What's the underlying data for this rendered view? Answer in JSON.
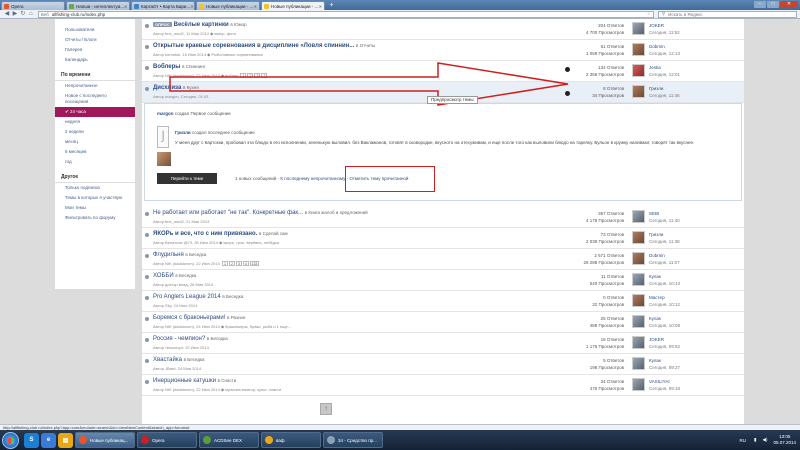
{
  "browser": {
    "tabs": [
      {
        "label": "Opera",
        "active": false
      },
      {
        "label": "Напша - интеллектуа...",
        "active": false
      },
      {
        "label": "КартаОт • Карта Бари...",
        "active": false
      },
      {
        "label": "Новые публикации - ...",
        "active": false
      },
      {
        "label": "Новые публикации - ...",
        "active": true
      }
    ],
    "url_prefix": "Веб",
    "url": "allfishing-club.ru/index.php",
    "search_placeholder": "Искать в Яндекс"
  },
  "sidebar": {
    "top_items": [
      "Пользователи",
      "Отчеты / Блоги",
      "Галерея",
      "Календарь"
    ],
    "section_time": "По времени",
    "time_items": [
      {
        "label": "Непрочитанное",
        "active": false
      },
      {
        "label": "Новое с последнего посещения",
        "active": false
      },
      {
        "label": "24 часа",
        "active": true
      },
      {
        "label": "неделя",
        "active": false
      },
      {
        "label": "2 недели",
        "active": false
      },
      {
        "label": "месяц",
        "active": false
      },
      {
        "label": "6 месяцев",
        "active": false
      },
      {
        "label": "год",
        "active": false
      }
    ],
    "section_other": "Другое",
    "other_items": [
      "Только подписка",
      "Темы в которых я участвую",
      "Мои темы",
      "Фильтровать по форуму"
    ]
  },
  "topics": [
    {
      "tag": "ОПРОС",
      "title": "Весёлые картинки",
      "forum": "в Юмор",
      "meta": "Автор text_mod2, 11 Мая 2014",
      "extra": "юмор, фото",
      "replies": "204 Ответов",
      "views": "4 700 Просмотров",
      "user": "JOKER",
      "time": "Сегодня, 11:52",
      "bold": true
    },
    {
      "tag": "",
      "title": "Открытые краевые соревнования в дисциплине «Ловля спиннин...",
      "forum": "в Отчеты",
      "meta": "Автор kornstok, 15 Июн 2014",
      "extra": "Рыболовные соревнования",
      "replies": "51 Ответов",
      "views": "1 059 Просмотров",
      "user": "Dobrnin",
      "time": "Сегодня, 12:13",
      "bold": true
    },
    {
      "tag": "",
      "title": "Воблеры",
      "forum": "в Спиннинг",
      "meta": "Автор NIK (dadukovm), 22 Июн 2014",
      "extra": "воблер",
      "pages": [
        "1",
        "2",
        "3",
        "7"
      ],
      "replies": "134 Ответов",
      "views": "2 356 Просмотров",
      "user": "Jeska",
      "time": "Сегодня, 12:01",
      "bold": true
    },
    {
      "tag": "",
      "title": "Дисхлиза",
      "forum": "в Кухня",
      "meta": "Автор margon, Сегодня, 01:03",
      "extra": "",
      "replies": "8 Ответов",
      "views": "34 Просмотров",
      "user": "Гризли",
      "time": "Сегодня, 11:45",
      "bold": true
    }
  ],
  "preview": {
    "starter_user": "margon",
    "starter_text": "создал Первое сообщение",
    "last_user": "Гризли",
    "last_text": "создал последнее сообщение",
    "body": "У меня друг с Картохки, пробовал эта блюдо в его исполнении, зеленькую выловил. без Ваклажанов, готовят в сковородке, вкусното на отесуживам, и еще после того как выловили блюдо на тарелку. Бульон в кружку наливают, говорят так вкуснее.",
    "go_button": "Перейти к теме",
    "new_messages": "1 новых сообщений",
    "last_unread": "К последнему непрочитанному",
    "mark_read": "Отметить тему прочитанной",
    "tooltip": "Предпросмотр темы"
  },
  "topics2": [
    {
      "title": "Не работает или работает \"не так\". Конкретные фак...",
      "forum": "в Книга жалоб и предложений",
      "meta": "Автор text_mod2, 21 Мая 2014",
      "replies": "367 Ответов",
      "views": "4 178 Просмотров",
      "user": "SEBI",
      "time": "Сегодня, 11:40",
      "bold": false
    },
    {
      "title": "ЯКОРь и все, что с ним привязано.",
      "forum": "в Сделай сам",
      "meta": "Автор Венатсов @73, 30 Июн 2014",
      "extra": "якорь, трос, верёвка, лебёдка",
      "replies": "73 Ответов",
      "views": "2 039 Просмотров",
      "user": "Гризли",
      "time": "Сегодня, 11:38",
      "bold": true
    },
    {
      "title": "Флудильня",
      "forum": "в Беседка",
      "meta": "Автор NIK (dadukovm), 22 Июн 2014",
      "pages": [
        "1",
        "2",
        "3",
        "4",
        "133"
      ],
      "replies": "2 671 Ответов",
      "views": "28 288 Просмотров",
      "user": "Dobrnin",
      "time": "Сегодня, 11:07",
      "bold": false
    },
    {
      "title": "ХОББИ",
      "forum": "в Беседка",
      "meta": "Автор доктор влад, 26 Мая 2014",
      "replies": "11 Ответов",
      "views": "540 Просмотров",
      "user": "Кулак",
      "time": "Сегодня, 10:43",
      "bold": false
    },
    {
      "title": "Pro Anglers League 2014",
      "forum": "в Беседка",
      "meta": "Автор Sky, 24 Июн 2014",
      "replies": "0 Ответов",
      "views": "32 Просмотров",
      "user": "Мастер",
      "time": "Сегодня, 10:12",
      "bold": false
    },
    {
      "title": "Боремся с браконьерами!",
      "forum": "в Разное",
      "meta": "Автор NIK (dadukovm), 24 Июн 2014",
      "extra": "браконьеры, браки, рыба и 1 еще...",
      "replies": "25 Ответов",
      "views": "488 Просмотров",
      "user": "Кулак",
      "time": "Сегодня, 10:08",
      "bold": false
    },
    {
      "title": "Россия - чемпион?",
      "forum": "в Беседка",
      "meta": "Автор телкспорт, 22 Июн 2014",
      "replies": "15 Ответов",
      "views": "1 176 Просмотров",
      "user": "JOKER",
      "time": "Сегодня, 09:52",
      "bold": false
    },
    {
      "title": "Хвастайка",
      "forum": "в Беседка",
      "meta": "Автор JBard, 24 Мая 2014",
      "replies": "5 Ответов",
      "views": "198 Просмотров",
      "user": "Кулак",
      "time": "Сегодня, 09:27",
      "bold": false
    },
    {
      "title": "Инерционные катушки",
      "forum": "в Снасти",
      "meta": "Автор NIK (dadukovm), 22 Июн 2014",
      "extra": "мультипликатор, культ, снасти",
      "replies": "34 Ответов",
      "views": "476 Просмотров",
      "user": "VASILIYAI",
      "time": "Сегодня, 09:18",
      "bold": false
    }
  ],
  "statusbar": "http://allfishing-club.ru/index.php?app=core&module=search&do=viewNewContent&search_app=forums#",
  "taskbar": {
    "windows": [
      {
        "label": "Новые публикац...",
        "active": true
      },
      {
        "label": "Opera",
        "active": false
      },
      {
        "label": "ACDSee DEX",
        "active": false
      },
      {
        "label": "ваф",
        "active": false
      },
      {
        "label": "34 - Средство пр...",
        "active": false
      }
    ],
    "lang": "RU",
    "time": "13:05",
    "date": "05.07.2014"
  },
  "colors": {
    "accent": "#a0185a",
    "link": "#2d4c84",
    "annotation": "#d11e1e"
  }
}
